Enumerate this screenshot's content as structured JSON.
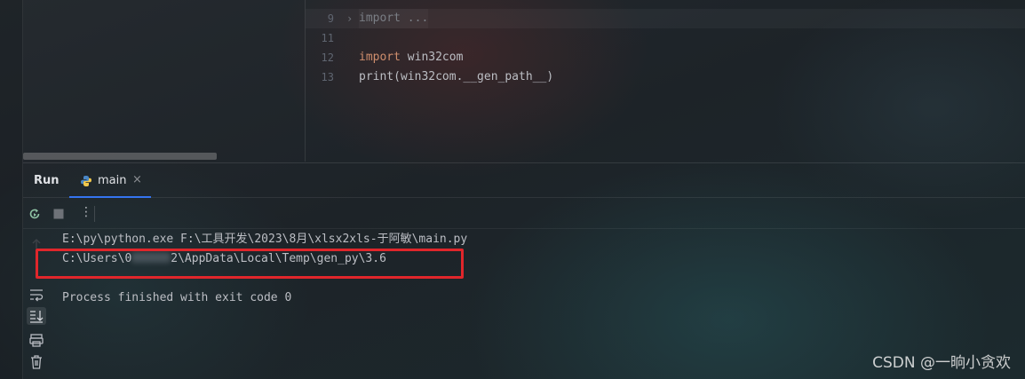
{
  "editor": {
    "lines": [
      {
        "no": "9",
        "text": "import ...",
        "folded": true
      },
      {
        "no": "11",
        "text": ""
      },
      {
        "no": "12",
        "keyword": "import",
        "rest": " win32com"
      },
      {
        "no": "13",
        "text": "print(win32com.__gen_path__)"
      }
    ]
  },
  "run": {
    "title": "Run",
    "tab_label": "main",
    "tab_close": "×",
    "menu_glyph": "⋮"
  },
  "console": {
    "command_line": "E:\\py\\python.exe F:\\工具开发\\2023\\8月\\xlsx2xls-于阿敏\\main.py",
    "path_prefix": "C:\\Users\\0",
    "path_suffix": "2\\AppData\\Local\\Temp\\gen_py\\3.6",
    "exit_message": "Process finished with exit code 0"
  },
  "watermark": "CSDN @一晌小贪欢",
  "colors": {
    "highlight": "#e0262b",
    "tab_underline": "#3574f0",
    "keyword": "#cf8e6d"
  }
}
